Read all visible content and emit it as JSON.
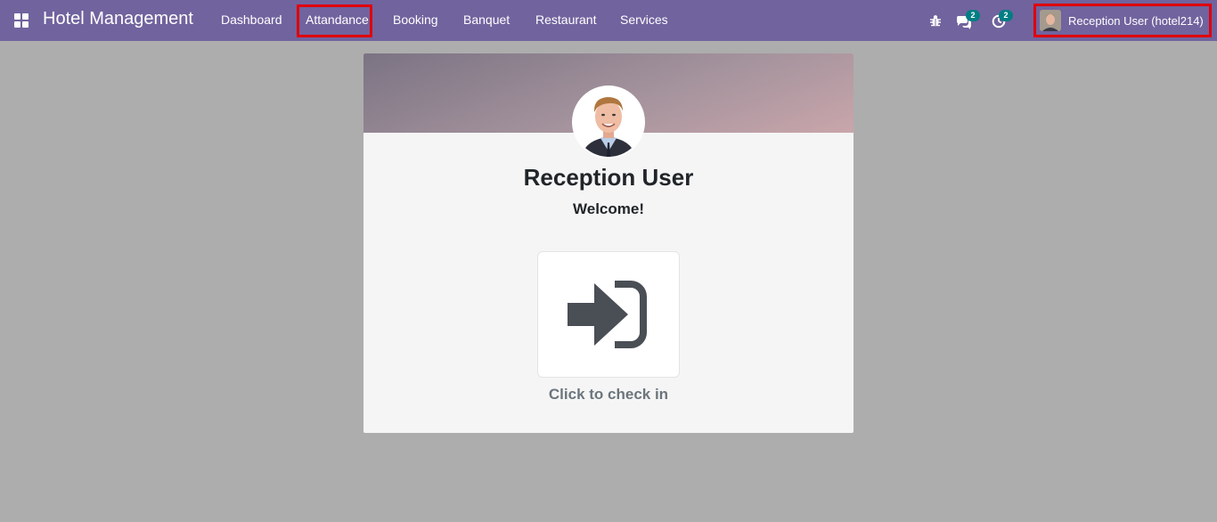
{
  "navbar": {
    "app_title": "Hotel Management",
    "menu": [
      "Dashboard",
      "Attandance",
      "Booking",
      "Banquet",
      "Restaurant",
      "Services"
    ],
    "messages_count": "2",
    "activities_count": "2",
    "user_label": "Reception User (hotel214)",
    "icons": [
      "apps-grid-icon",
      "bug-icon",
      "chat-icon",
      "clock-icon"
    ],
    "accent_color": "#71639e",
    "badge_color": "#017e84",
    "highlight_color": "#e0000b"
  },
  "attendance": {
    "employee_name": "Reception User",
    "greeting": "Welcome!",
    "checkin_label": "Click to check in",
    "checkin_icon": "sign-in-icon"
  }
}
